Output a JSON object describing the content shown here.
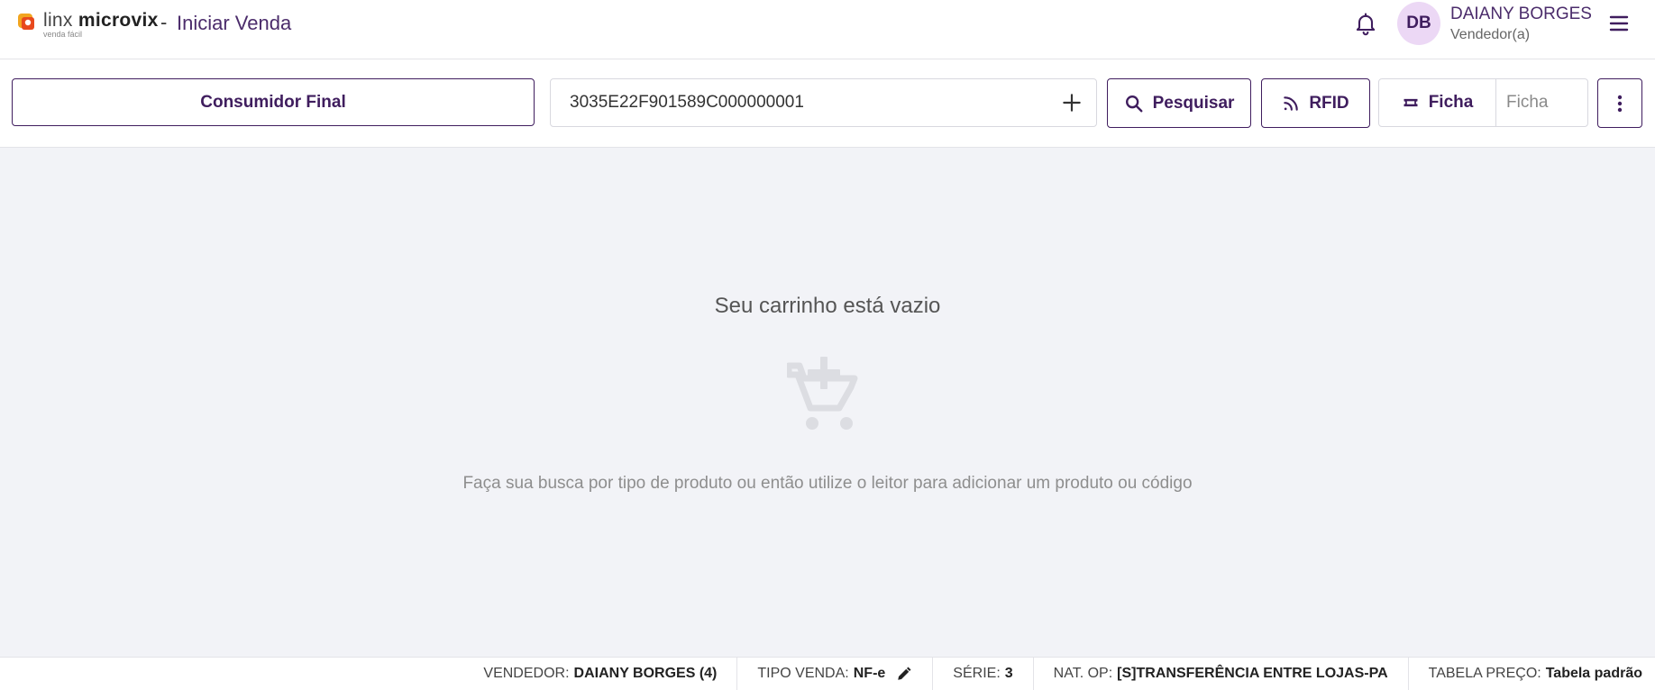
{
  "app": {
    "logo_text_left": "linx",
    "logo_text_right": "microvix",
    "logo_subtext": "venda fácil",
    "title_separator": "-",
    "page_title": "Iniciar Venda",
    "brand_color": "#3f1d5e",
    "accent_color": "#ecd8f5"
  },
  "header": {
    "notification_icon": "bell-icon",
    "user_initials": "DB",
    "user_name": "DAIANY BORGES",
    "user_role": "Vendedor(a)",
    "menu_icon": "hamburger-icon"
  },
  "toolbar": {
    "customer_label": "Consumidor Final",
    "search_value": "3035E22F901589C000000001",
    "search_add_icon": "plus-icon",
    "search_button_label": "Pesquisar",
    "rfid_button_label": "RFID",
    "ficha_button_label": "Ficha",
    "ficha_placeholder": "Ficha",
    "more_icon": "more-vertical-icon"
  },
  "cart": {
    "empty_title": "Seu carrinho está vazio",
    "empty_icon": "add-shopping-cart-icon",
    "empty_hint": "Faça sua busca por tipo de produto ou então utilize o leitor para adicionar um produto ou código"
  },
  "status": {
    "vendedor_label": "VENDEDOR:",
    "vendedor_value": "DAIANY BORGES (4)",
    "tipo_venda_label": "TIPO VENDA:",
    "tipo_venda_value": "NF-e",
    "serie_label": "SÉRIE:",
    "serie_value": "3",
    "nat_op_label": "NAT. OP:",
    "nat_op_value": "[S]TRANSFERÊNCIA ENTRE LOJAS-PA",
    "tabela_label": "TABELA PREÇO:",
    "tabela_value": "Tabela padrão"
  }
}
